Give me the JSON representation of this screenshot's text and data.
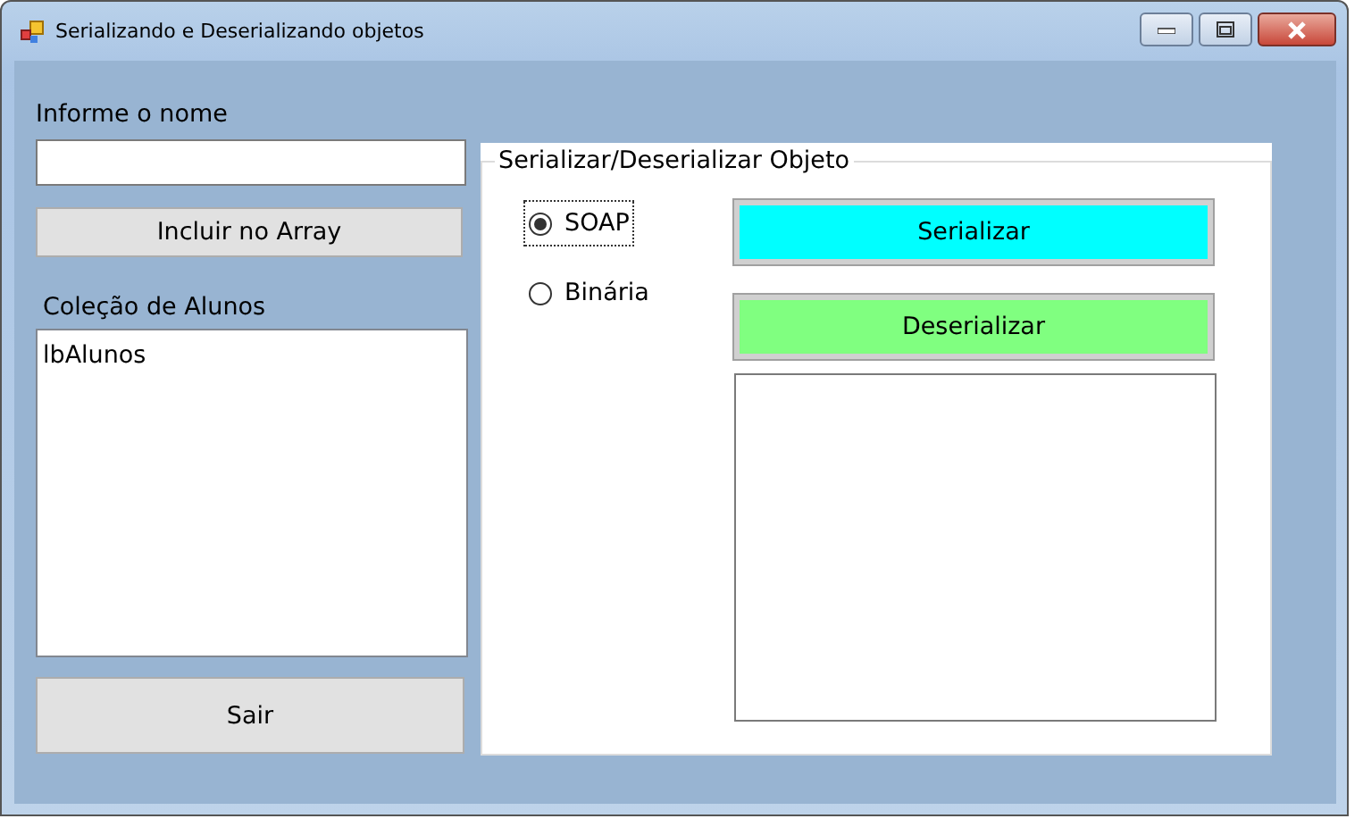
{
  "window": {
    "title": "Serializando e Deserializando objetos"
  },
  "name_label": "Informe o nome",
  "add_button": "Incluir no Array",
  "list_label": "Coleção de Alunos",
  "list": {
    "items": [
      "lbAlunos"
    ]
  },
  "exit_button": "Sair",
  "group": {
    "title": "Serializar/Deserializar Objeto",
    "options": [
      {
        "label": "SOAP",
        "selected": true,
        "focused": true
      },
      {
        "label": "Binária",
        "selected": false,
        "focused": false
      }
    ],
    "buttons": [
      {
        "label": "Serializar",
        "color": "#00ffff"
      },
      {
        "label": "Deserializar",
        "color": "#80ff80"
      }
    ]
  }
}
